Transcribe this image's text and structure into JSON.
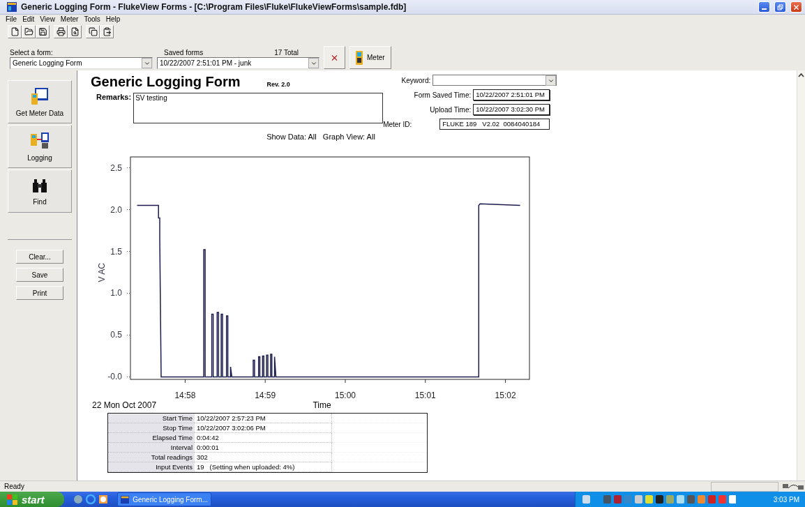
{
  "window": {
    "title": "Generic Logging Form - FlukeView Forms - [C:\\Program Files\\Fluke\\FlukeViewForms\\sample.fdb]"
  },
  "menu": [
    "File",
    "Edit",
    "View",
    "Meter",
    "Tools",
    "Help"
  ],
  "selector": {
    "form_label": "Select a form:",
    "form_value": "Generic Logging Form",
    "saved_label": "Saved forms",
    "saved_count": "17 Total",
    "saved_value": "10/22/2007 2:51:01 PM - junk",
    "meter_button": "Meter"
  },
  "sidebar": {
    "buttons": [
      {
        "kind": "meter",
        "label": "Get Meter Data"
      },
      {
        "kind": "logging",
        "label": "Logging"
      },
      {
        "kind": "find",
        "label": "Find"
      }
    ],
    "actions": [
      "Clear...",
      "Save",
      "Print"
    ]
  },
  "form": {
    "title": "Generic Logging Form",
    "revision": "Rev. 2.0",
    "remarks_label": "Remarks:",
    "remarks_value": "SV testing",
    "keyword_label": "Keyword:",
    "fields": [
      {
        "label": "Form Saved Time:",
        "value": "10/22/2007 2:51:01 PM"
      },
      {
        "label": "Upload Time:",
        "value": "10/22/2007 3:02:30 PM"
      }
    ],
    "meter_id_label": "Meter ID:",
    "meter_id_value": "FLUKE 189   V2.02  0084040184",
    "view_options": "Show Data: All   Graph View: All",
    "chart_data": {
      "type": "line",
      "xlabel": "Time",
      "ylabel": "V AC",
      "xlim": [
        897.317,
        902.3
      ],
      "ylim": [
        -0.03,
        2.63
      ],
      "xticks": [
        {
          "value": 898,
          "label": "14:58"
        },
        {
          "value": 899,
          "label": "14:59"
        },
        {
          "value": 900,
          "label": "15:00"
        },
        {
          "value": 901,
          "label": "15:01"
        },
        {
          "value": 902,
          "label": "15:02"
        }
      ],
      "yticks": [
        {
          "value": 0,
          "label": "-0.0"
        },
        {
          "value": 0.5,
          "label": "0.5"
        },
        {
          "value": 1,
          "label": "1.0"
        },
        {
          "value": 1.5,
          "label": "1.5"
        },
        {
          "value": 2,
          "label": "2.0"
        },
        {
          "value": 2.5,
          "label": "2.5"
        }
      ],
      "x": [
        897.4,
        897.667,
        897.667,
        897.683,
        897.683,
        897.7,
        898.233,
        898.233,
        898.25,
        898.25,
        898.333,
        898.333,
        898.35,
        898.35,
        898.4,
        898.4,
        898.417,
        898.417,
        898.45,
        898.45,
        898.467,
        898.467,
        898.517,
        898.517,
        898.533,
        898.533,
        898.567,
        898.567,
        898.583,
        898.85,
        898.85,
        898.867,
        898.867,
        898.917,
        898.917,
        898.933,
        898.933,
        898.967,
        898.967,
        898.983,
        898.983,
        899.017,
        899.017,
        899.033,
        899.033,
        899.067,
        899.067,
        899.083,
        899.083,
        899.117,
        899.117,
        899.133,
        901.667,
        901.667,
        901.683,
        902.183
      ],
      "series": [
        {
          "color": "#1c1c4c",
          "values": [
            2.05,
            2.05,
            1.9,
            1.9,
            1.65,
            0,
            0,
            1.52,
            1.52,
            0,
            0,
            0.75,
            0.75,
            0,
            0,
            0.77,
            0.77,
            0,
            0,
            0.75,
            0.75,
            0,
            0,
            0.73,
            0.73,
            0,
            0,
            0.12,
            0,
            0,
            0.2,
            0.2,
            0,
            0,
            0.24,
            0.24,
            0,
            0,
            0.25,
            0.25,
            0,
            0,
            0.26,
            0.26,
            0,
            0,
            0.27,
            0.27,
            0,
            0,
            0.24,
            0,
            0,
            2.05,
            2.07,
            2.05
          ]
        }
      ]
    },
    "date_label": "22 Mon Oct 2007",
    "summary": [
      {
        "label": "Start Time",
        "value": "10/22/2007 2:57:23 PM"
      },
      {
        "label": "Stop Time",
        "value": "10/22/2007 3:02:06 PM"
      },
      {
        "label": "Elapsed Time",
        "value": "0:04:42"
      },
      {
        "label": "Interval",
        "value": "0:00:01"
      },
      {
        "label": "Total readings",
        "value": "302"
      },
      {
        "label": "Input Events",
        "value": "19   (Setting when uploaded: 4%)"
      }
    ]
  },
  "status_bar": "Ready",
  "taskbar": {
    "start": "start",
    "task": "Generic Logging Form...",
    "clock": "3:03 PM"
  }
}
